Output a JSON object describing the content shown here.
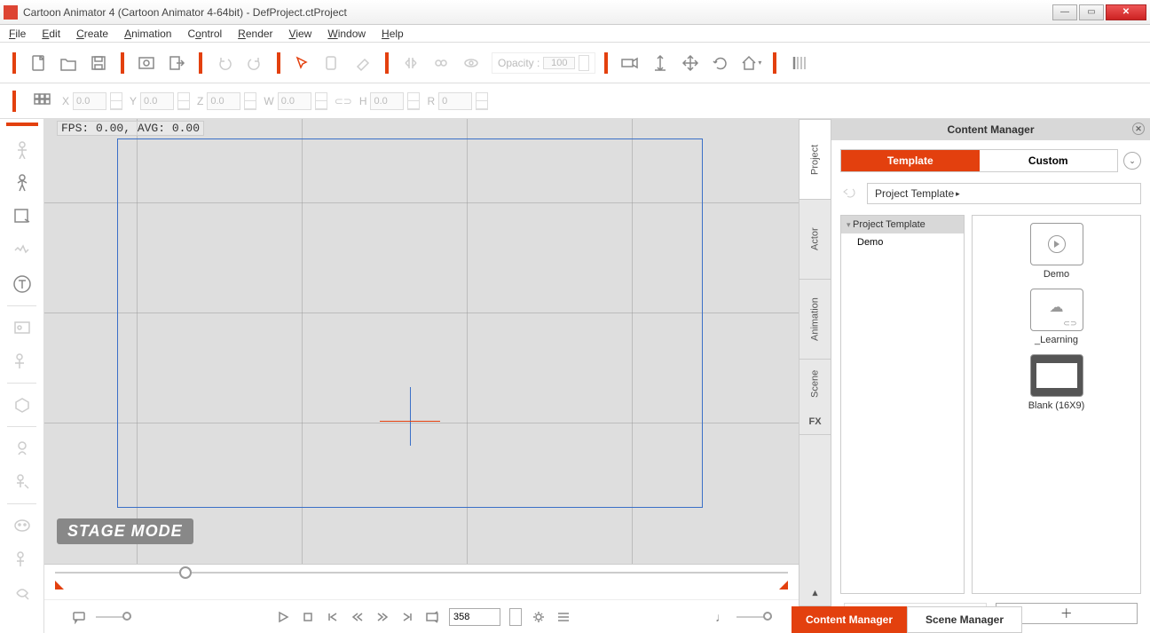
{
  "titlebar": {
    "title": "Cartoon Animator 4  (Cartoon Animator 4-64bit) - DefProject.ctProject"
  },
  "menu": {
    "file": "File",
    "edit": "Edit",
    "create": "Create",
    "animation": "Animation",
    "control": "Control",
    "render": "Render",
    "view": "View",
    "window": "Window",
    "help": "Help"
  },
  "toolbar": {
    "opacity_label": "Opacity :",
    "opacity_value": "100"
  },
  "transform": {
    "x": "0.0",
    "y": "0.0",
    "z": "0.0",
    "w": "0.0",
    "h": "0.0",
    "r": "0"
  },
  "stage": {
    "fps": "FPS: 0.00, AVG: 0.00",
    "mode": "STAGE MODE"
  },
  "playback": {
    "frame": "358"
  },
  "content_manager": {
    "title": "Content Manager",
    "tab_template": "Template",
    "tab_custom": "Custom",
    "breadcrumb": "Project Template",
    "tree_header": "Project Template",
    "tree_items": [
      "Demo"
    ],
    "thumbs": [
      {
        "name": "Demo"
      },
      {
        "name": "_Learning"
      },
      {
        "name": "Blank (16X9)"
      }
    ]
  },
  "vtabs": {
    "project": "Project",
    "actor": "Actor",
    "animation": "Animation",
    "scene": "Scene",
    "fx": "FX"
  },
  "managers": {
    "content": "Content Manager",
    "scene": "Scene Manager"
  }
}
